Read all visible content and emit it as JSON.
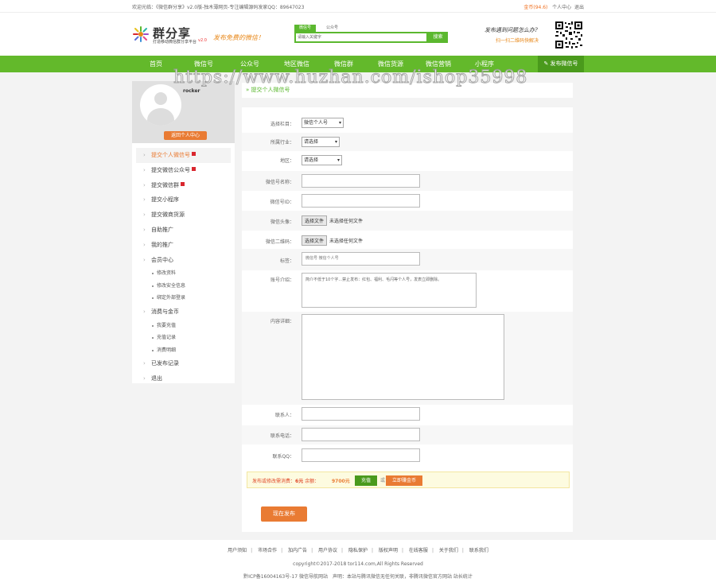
{
  "topbar": {
    "welcome": "欢迎光临：《微信群分享》v2.0版-独木薄网页-专注编辑源码发家QQ：89647023",
    "gold": "金币(94.6)",
    "user_center": "个人中心",
    "logout": "退出"
  },
  "header": {
    "logo_title": "群分享",
    "logo_sub": "打造移动微信群分享平台",
    "logo_version": "v2.0",
    "slogan": "发布免费的微信！",
    "search": {
      "tab_active": "微信号",
      "tab_other": "公众号",
      "placeholder": "请输入关键字",
      "button": "搜索"
    },
    "qr_text1": "发布遇到问题怎么办?",
    "qr_text2": "扫一扫二维码快解决"
  },
  "nav": {
    "items": [
      "首页",
      "微信号",
      "公众号",
      "地区微信",
      "微信群",
      "微信货源",
      "微信营销",
      "小程序"
    ],
    "publish": "发布微信号"
  },
  "watermark": "https://www.huzhan.com/ishop35998",
  "sidebar": {
    "username": "rocker",
    "back_button": "返回个人中心",
    "menu": [
      {
        "label": "提交个人微信号",
        "active": true,
        "flag": true
      },
      {
        "label": "提交微信公众号",
        "flag": true
      },
      {
        "label": "提交微信群",
        "flag": true
      },
      {
        "label": "提交小程序"
      },
      {
        "label": "提交微商货源"
      },
      {
        "label": "自助推广"
      },
      {
        "label": "我的推广"
      },
      {
        "label": "会员中心"
      }
    ],
    "member_sub": [
      "修改资料",
      "修改安全信息",
      "绑定外部登录"
    ],
    "finance": "消费与金币",
    "finance_sub": [
      "我要充值",
      "充值记录",
      "消费明细"
    ],
    "published": "已发布记录",
    "exit": "退出"
  },
  "page_title": "» 提交个人微信号",
  "form": {
    "column_label": "选择栏目：",
    "column_value": "微信个人号",
    "industry_label": "所属行业：",
    "industry_value": "请选择",
    "region_label": "地区：",
    "region_value": "请选择",
    "wx_name_label": "微信号名称：",
    "wx_id_label": "微信号ID：",
    "avatar_label": "微信头像：",
    "qr_label": "微信二维码：",
    "file_button": "选择文件",
    "file_none": "未选择任何文件",
    "tag_label": "标签：",
    "tag_placeholder": "微信号 微信个人号",
    "intro_label": "账号介绍：",
    "intro_placeholder": "简介不低于10个字...禁止发布：红包、福利、毛闪等个人号，发表立即删除。",
    "detail_label": "内容详细：",
    "contact_label": "联系人：",
    "phone_label": "联系电话：",
    "qq_label": "联系QQ：",
    "fee_text": "发布或修改需消费：",
    "fee_price": "6元",
    "fee_balance_label": "余额：",
    "fee_balance": "9700元",
    "recharge": "充值",
    "or": "或",
    "get_gold": "立即赚金币",
    "submit": "现在发布"
  },
  "footer": {
    "links": [
      "用户须知",
      "市场合作",
      "加内广告",
      "用户协议",
      "隐私保护",
      "版权声明",
      "在线客服",
      "关于我们",
      "联系我们"
    ],
    "copyright": "copyright©2017-2018 tor114.com,All Rights Reserved",
    "icp": "黔ICP备16004163号-17 微信导航网站　声明：本站与腾讯微信无任何关联，非腾讯微信官方网站 站长统计"
  },
  "colors": {
    "green": "#63b92b",
    "orange": "#e97b33"
  }
}
